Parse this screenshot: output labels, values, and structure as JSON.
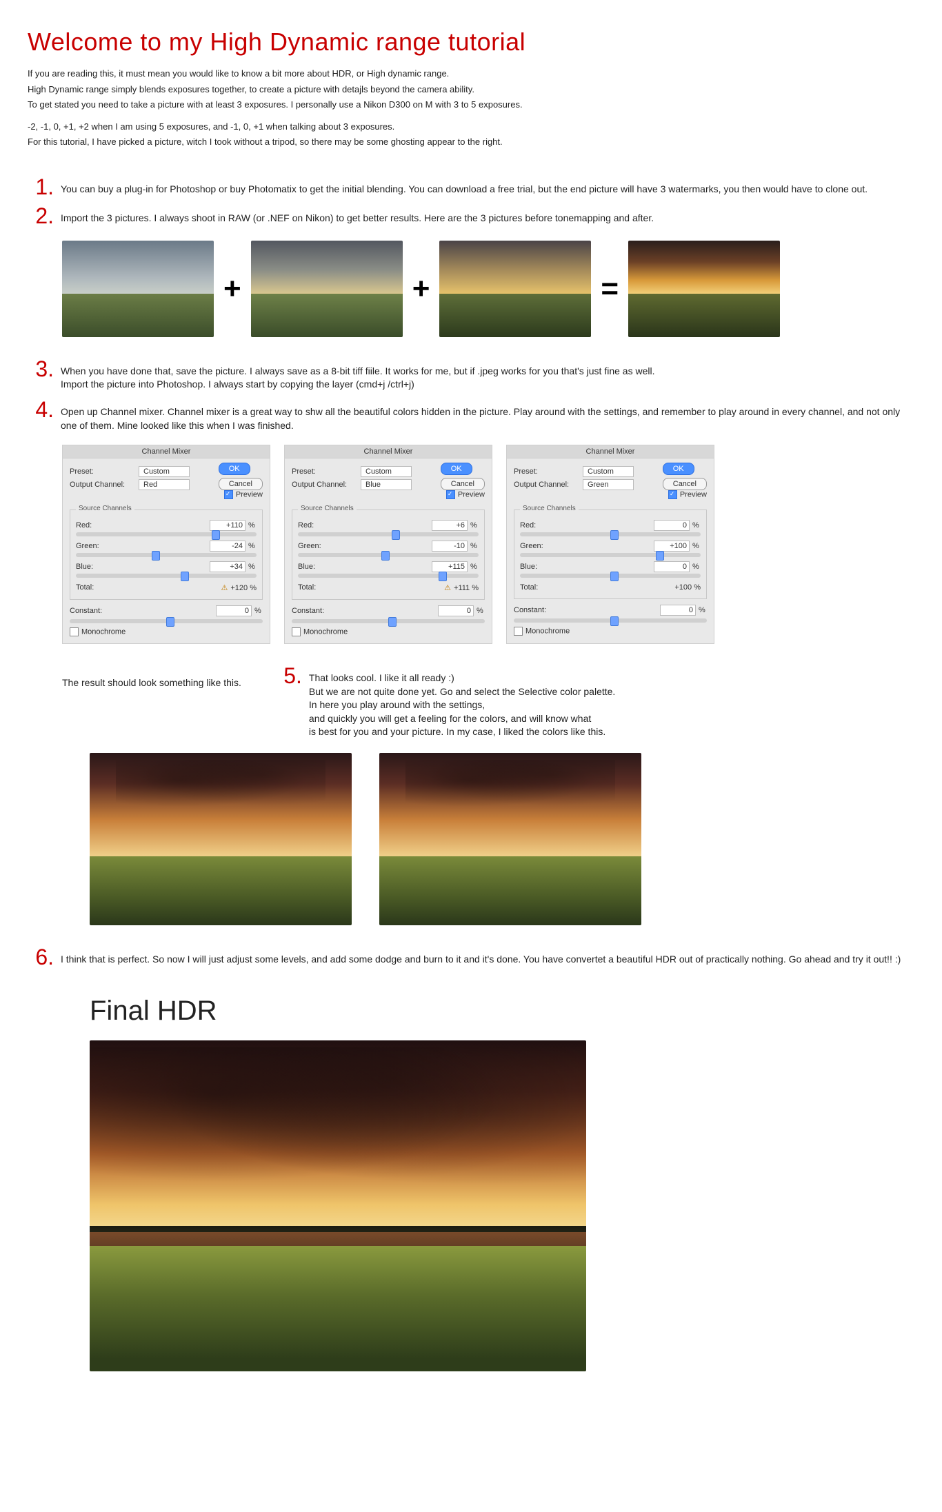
{
  "title": "Welcome to my High Dynamic range tutorial",
  "intro": {
    "p1": "If you are reading this, it must mean you would like to know a bit more about HDR, or High dynamic range.",
    "p2": "High Dynamic range simply blends exposures together, to create a picture with detajls beyond the camera ability.",
    "p3": "To get stated you need to take a picture with at least 3 exposures. I personally use a Nikon D300 on M with 3 to 5 exposures.",
    "p4": "-2, -1, 0, +1, +2 when I am using 5 exposures, and -1, 0, +1 when talking about 3 exposures.",
    "p5": "For this tutorial, I have picked a picture, witch I took without a tripod, so there may be some ghosting appear to the right."
  },
  "steps": {
    "s1": "You can buy a plug-in for Photoshop or buy Photomatix to get the initial blending. You can download a free trial, but the end picture will have 3 watermarks, you then would have to clone out.",
    "s2": "Import the 3 pictures. I always shoot in RAW (or .NEF on Nikon) to get better results. Here are the 3 pictures before tonemapping and after.",
    "s3": "When you have done that, save the picture. I always save as a 8-bit tiff fiile. It works for me, but if .jpeg works for you that's just fine as well.\nImport the picture into Photoshop. I always start by copying the layer (cmd+j /ctrl+j)",
    "s4": "Open up Channel mixer. Channel mixer is a great way to shw all the beautiful colors hidden in the picture. Play around with the settings, and remember to play around in every channel, and not only one of them. Mine looked like this when I was finished.",
    "result_label": "The result should look something like this.",
    "s5": "That looks cool. I like it all ready :)\nBut we are not quite done yet. Go and select the Selective color palette.\n In here you play around with the settings,\nand quickly you will get a feeling for the colors, and will know what\nis best for you and your picture. In my case, I liked the colors like this.",
    "s6": "I think that is perfect. So now I will just adjust some levels, and add some dodge and burn to it and it's done. You have convertet a beautiful HDR out of practically nothing. Go ahead and try it out!! :)"
  },
  "ops": {
    "plus": "+",
    "equals": "="
  },
  "cm_common": {
    "title": "Channel Mixer",
    "preset_label": "Preset:",
    "preset_value": "Custom",
    "output_label": "Output Channel:",
    "ok": "OK",
    "cancel": "Cancel",
    "preview": "Preview",
    "group": "Source Channels",
    "red": "Red:",
    "green": "Green:",
    "blue": "Blue:",
    "total": "Total:",
    "constant": "Constant:",
    "mono": "Monochrome",
    "pct": "%"
  },
  "cm": [
    {
      "output": "Red",
      "red": "+110",
      "green": "-24",
      "blue": "+34",
      "total": "+120 %",
      "warn": true,
      "constant": "0"
    },
    {
      "output": "Blue",
      "red": "+6",
      "green": "-10",
      "blue": "+115",
      "total": "+111 %",
      "warn": true,
      "constant": "0"
    },
    {
      "output": "Green",
      "red": "0",
      "green": "+100",
      "blue": "0",
      "total": "+100 %",
      "warn": false,
      "constant": "0"
    }
  ],
  "final_title": "Final HDR"
}
